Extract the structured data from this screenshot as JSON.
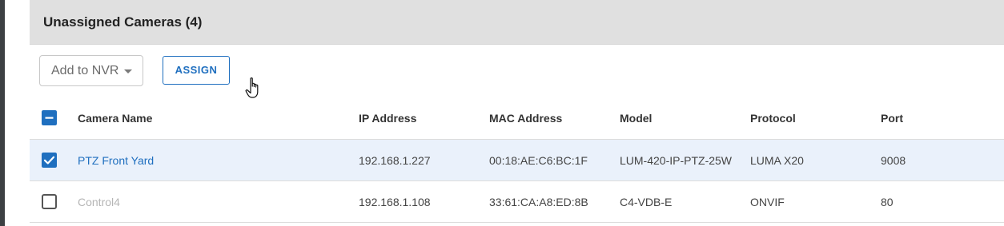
{
  "panel": {
    "title": "Unassigned Cameras (4)"
  },
  "toolbar": {
    "nvr_select_value": "Add to NVR",
    "assign_label": "ASSIGN"
  },
  "table": {
    "columns": [
      "Camera Name",
      "IP Address",
      "MAC Address",
      "Model",
      "Protocol",
      "Port"
    ],
    "rows": [
      {
        "checked": true,
        "name": "PTZ Front Yard",
        "ip": "192.168.1.227",
        "mac": "00:18:AE:C6:BC:1F",
        "model": "LUM-420-IP-PTZ-25W",
        "protocol": "LUMA X20",
        "port": "9008"
      },
      {
        "checked": false,
        "name": "Control4",
        "ip": "192.168.1.108",
        "mac": "33:61:CA:A8:ED:8B",
        "model": "C4-VDB-E",
        "protocol": "ONVIF",
        "port": "80"
      }
    ]
  },
  "colors": {
    "accent": "#1f6fbf",
    "header_bg": "#e0e0e0",
    "selected_row_bg": "#eaf1fb",
    "disabled_text": "#b5b5b5"
  },
  "icons": {
    "select_all": "indeterminate-checkbox-icon",
    "row_checked": "checkbox-checked-icon",
    "row_unchecked": "checkbox-empty-icon",
    "caret": "caret-down-icon",
    "cursor": "hand-cursor-icon"
  }
}
